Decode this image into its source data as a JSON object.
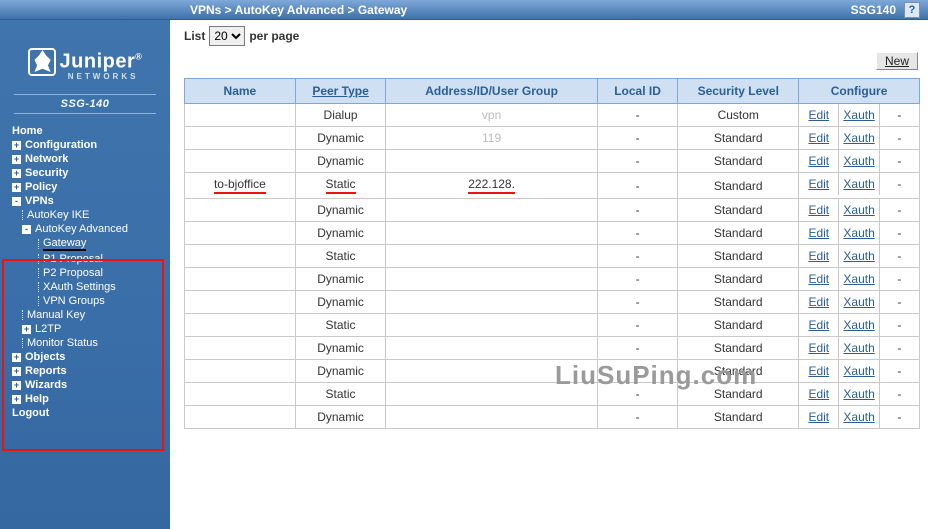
{
  "breadcrumb": "VPNs > AutoKey Advanced > Gateway",
  "device_tag": "SSG140",
  "help_label": "?",
  "logo_text": "Juniper",
  "logo_sub": "NETWORKS",
  "model": "SSG-140",
  "list_label_pre": "List",
  "list_label_post": "per page",
  "list_value": "20",
  "new_button": "New",
  "watermark": "LiuSuPing.com",
  "nav": [
    {
      "label": "Home",
      "lv": 0,
      "toggle": ""
    },
    {
      "label": "Configuration",
      "lv": 0,
      "toggle": "+"
    },
    {
      "label": "Network",
      "lv": 0,
      "toggle": "+"
    },
    {
      "label": "Security",
      "lv": 0,
      "toggle": "+"
    },
    {
      "label": "Policy",
      "lv": 0,
      "toggle": "+"
    },
    {
      "label": "VPNs",
      "lv": 0,
      "toggle": "-",
      "hl": true
    },
    {
      "label": "AutoKey IKE",
      "lv": 1,
      "toggle": ""
    },
    {
      "label": "AutoKey Advanced",
      "lv": 1,
      "toggle": "-"
    },
    {
      "label": "Gateway",
      "lv": 2,
      "toggle": "",
      "mark": "black"
    },
    {
      "label": "P1 Proposal",
      "lv": 2,
      "toggle": ""
    },
    {
      "label": "P2 Proposal",
      "lv": 2,
      "toggle": ""
    },
    {
      "label": "XAuth Settings",
      "lv": 2,
      "toggle": ""
    },
    {
      "label": "VPN Groups",
      "lv": 2,
      "toggle": ""
    },
    {
      "label": "Manual Key",
      "lv": 1,
      "toggle": ""
    },
    {
      "label": "L2TP",
      "lv": 1,
      "toggle": "+"
    },
    {
      "label": "Monitor Status",
      "lv": 1,
      "toggle": ""
    },
    {
      "label": "Objects",
      "lv": 0,
      "toggle": "+"
    },
    {
      "label": "Reports",
      "lv": 0,
      "toggle": "+"
    },
    {
      "label": "Wizards",
      "lv": 0,
      "toggle": "+"
    },
    {
      "label": "Help",
      "lv": 0,
      "toggle": "+"
    },
    {
      "label": "Logout",
      "lv": 0,
      "toggle": ""
    }
  ],
  "columns": {
    "name": "Name",
    "peer": "Peer Type",
    "addr": "Address/ID/User Group",
    "local": "Local ID",
    "sec": "Security Level",
    "conf": "Configure"
  },
  "conf_links": {
    "edit": "Edit",
    "xauth": "Xauth",
    "remove": "-"
  },
  "rows": [
    {
      "name": "",
      "peer": "Dialup",
      "addr": "vpn",
      "local": "-",
      "sec": "Custom"
    },
    {
      "name": "",
      "peer": "Dynamic",
      "addr": "119",
      "local": "-",
      "sec": "Standard"
    },
    {
      "name": "",
      "peer": "Dynamic",
      "addr": "",
      "local": "-",
      "sec": "Standard"
    },
    {
      "name": "to-bjoffice",
      "peer": "Static",
      "addr": "222.128.",
      "local": "-",
      "sec": "Standard",
      "hl": true
    },
    {
      "name": "",
      "peer": "Dynamic",
      "addr": "",
      "local": "-",
      "sec": "Standard"
    },
    {
      "name": "",
      "peer": "Dynamic",
      "addr": "",
      "local": "-",
      "sec": "Standard"
    },
    {
      "name": "",
      "peer": "Static",
      "addr": "",
      "local": "-",
      "sec": "Standard"
    },
    {
      "name": "",
      "peer": "Dynamic",
      "addr": "",
      "local": "-",
      "sec": "Standard"
    },
    {
      "name": "",
      "peer": "Dynamic",
      "addr": "",
      "local": "-",
      "sec": "Standard"
    },
    {
      "name": "",
      "peer": "Static",
      "addr": "",
      "local": "-",
      "sec": "Standard"
    },
    {
      "name": "",
      "peer": "Dynamic",
      "addr": "",
      "local": "-",
      "sec": "Standard"
    },
    {
      "name": "",
      "peer": "Dynamic",
      "addr": "",
      "local": "-",
      "sec": "Standard"
    },
    {
      "name": "",
      "peer": "Static",
      "addr": "",
      "local": "-",
      "sec": "Standard"
    },
    {
      "name": "",
      "peer": "Dynamic",
      "addr": "",
      "local": "-",
      "sec": "Standard"
    }
  ]
}
